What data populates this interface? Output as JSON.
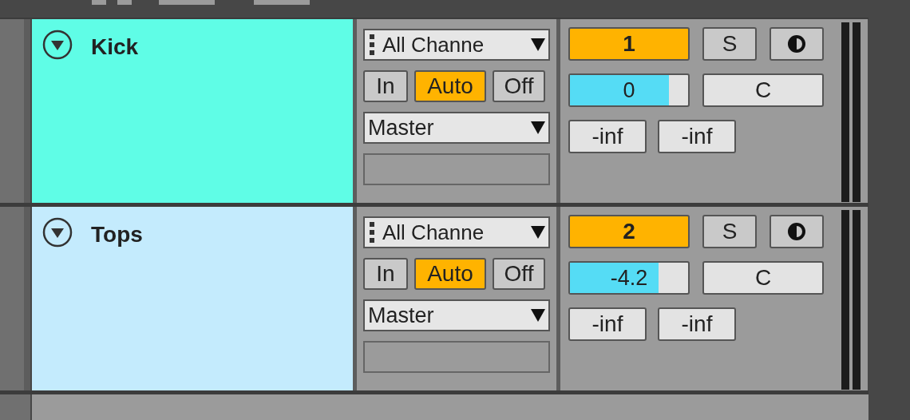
{
  "tracks": [
    {
      "name": "Kick",
      "color": "#5ffde6",
      "input": "All Channe",
      "monitor": [
        {
          "label": "In",
          "selected": false
        },
        {
          "label": "Auto",
          "selected": true
        },
        {
          "label": "Off",
          "selected": false
        }
      ],
      "output": "Master",
      "number": "1",
      "active": true,
      "solo": {
        "label": "S",
        "on": false
      },
      "volume": {
        "reading": "0",
        "level": 0.84
      },
      "pan": "C",
      "sends": [
        "-inf",
        "-inf"
      ]
    },
    {
      "name": "Tops",
      "color": "#c4ebfd",
      "input": "All Channe",
      "monitor": [
        {
          "label": "In",
          "selected": false
        },
        {
          "label": "Auto",
          "selected": true
        },
        {
          "label": "Off",
          "selected": false
        }
      ],
      "output": "Master",
      "number": "2",
      "active": true,
      "solo": {
        "label": "S",
        "on": false
      },
      "volume": {
        "reading": "-4.2",
        "level": 0.75
      },
      "pan": "C",
      "sends": [
        "-inf",
        "-inf"
      ]
    }
  ]
}
